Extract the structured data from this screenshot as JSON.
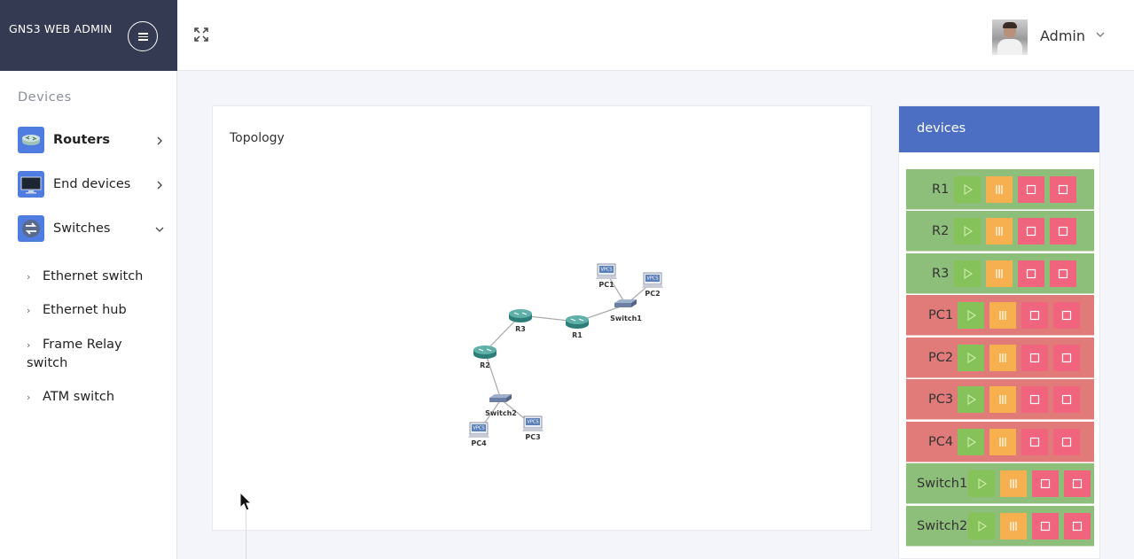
{
  "brand": {
    "title": "GNS3 WEB ADMIN"
  },
  "user": {
    "name": "Admin"
  },
  "sidebar": {
    "heading": "Devices",
    "categories": [
      {
        "label": "Routers",
        "icon": "router-icon"
      },
      {
        "label": "End devices",
        "icon": "monitor-icon"
      },
      {
        "label": "Switches",
        "icon": "switch-icon"
      }
    ],
    "switch_items": [
      "Ethernet switch",
      "Ethernet hub",
      "Frame Relay switch",
      "ATM switch"
    ]
  },
  "topology": {
    "title": "Topology",
    "nodes": [
      "R1",
      "R2",
      "R3",
      "Switch1",
      "Switch2",
      "PC1",
      "PC2",
      "PC3",
      "PC4"
    ],
    "links": [
      [
        "R3",
        "R1"
      ],
      [
        "R3",
        "R2"
      ],
      [
        "R1",
        "Switch1"
      ],
      [
        "Switch1",
        "PC1"
      ],
      [
        "Switch1",
        "PC2"
      ],
      [
        "R2",
        "Switch2"
      ],
      [
        "Switch2",
        "PC3"
      ],
      [
        "Switch2",
        "PC4"
      ]
    ],
    "vpc_badge": "VPCS"
  },
  "devices_panel": {
    "title": "devices",
    "rows": [
      {
        "name": "R1",
        "status": "started"
      },
      {
        "name": "R2",
        "status": "started"
      },
      {
        "name": "R3",
        "status": "started"
      },
      {
        "name": "PC1",
        "status": "stopped"
      },
      {
        "name": "PC2",
        "status": "stopped"
      },
      {
        "name": "PC3",
        "status": "stopped"
      },
      {
        "name": "PC4",
        "status": "stopped"
      },
      {
        "name": "Switch1",
        "status": "started"
      },
      {
        "name": "Switch2",
        "status": "started"
      }
    ]
  },
  "colors": {
    "brand_bg": "#343a51",
    "accent": "#4d6fc3",
    "row_started": "#8dbf7a",
    "row_stopped": "#e07b7a",
    "play": "#86c25a",
    "pause": "#f6b04f",
    "stop": "#f0647d"
  }
}
